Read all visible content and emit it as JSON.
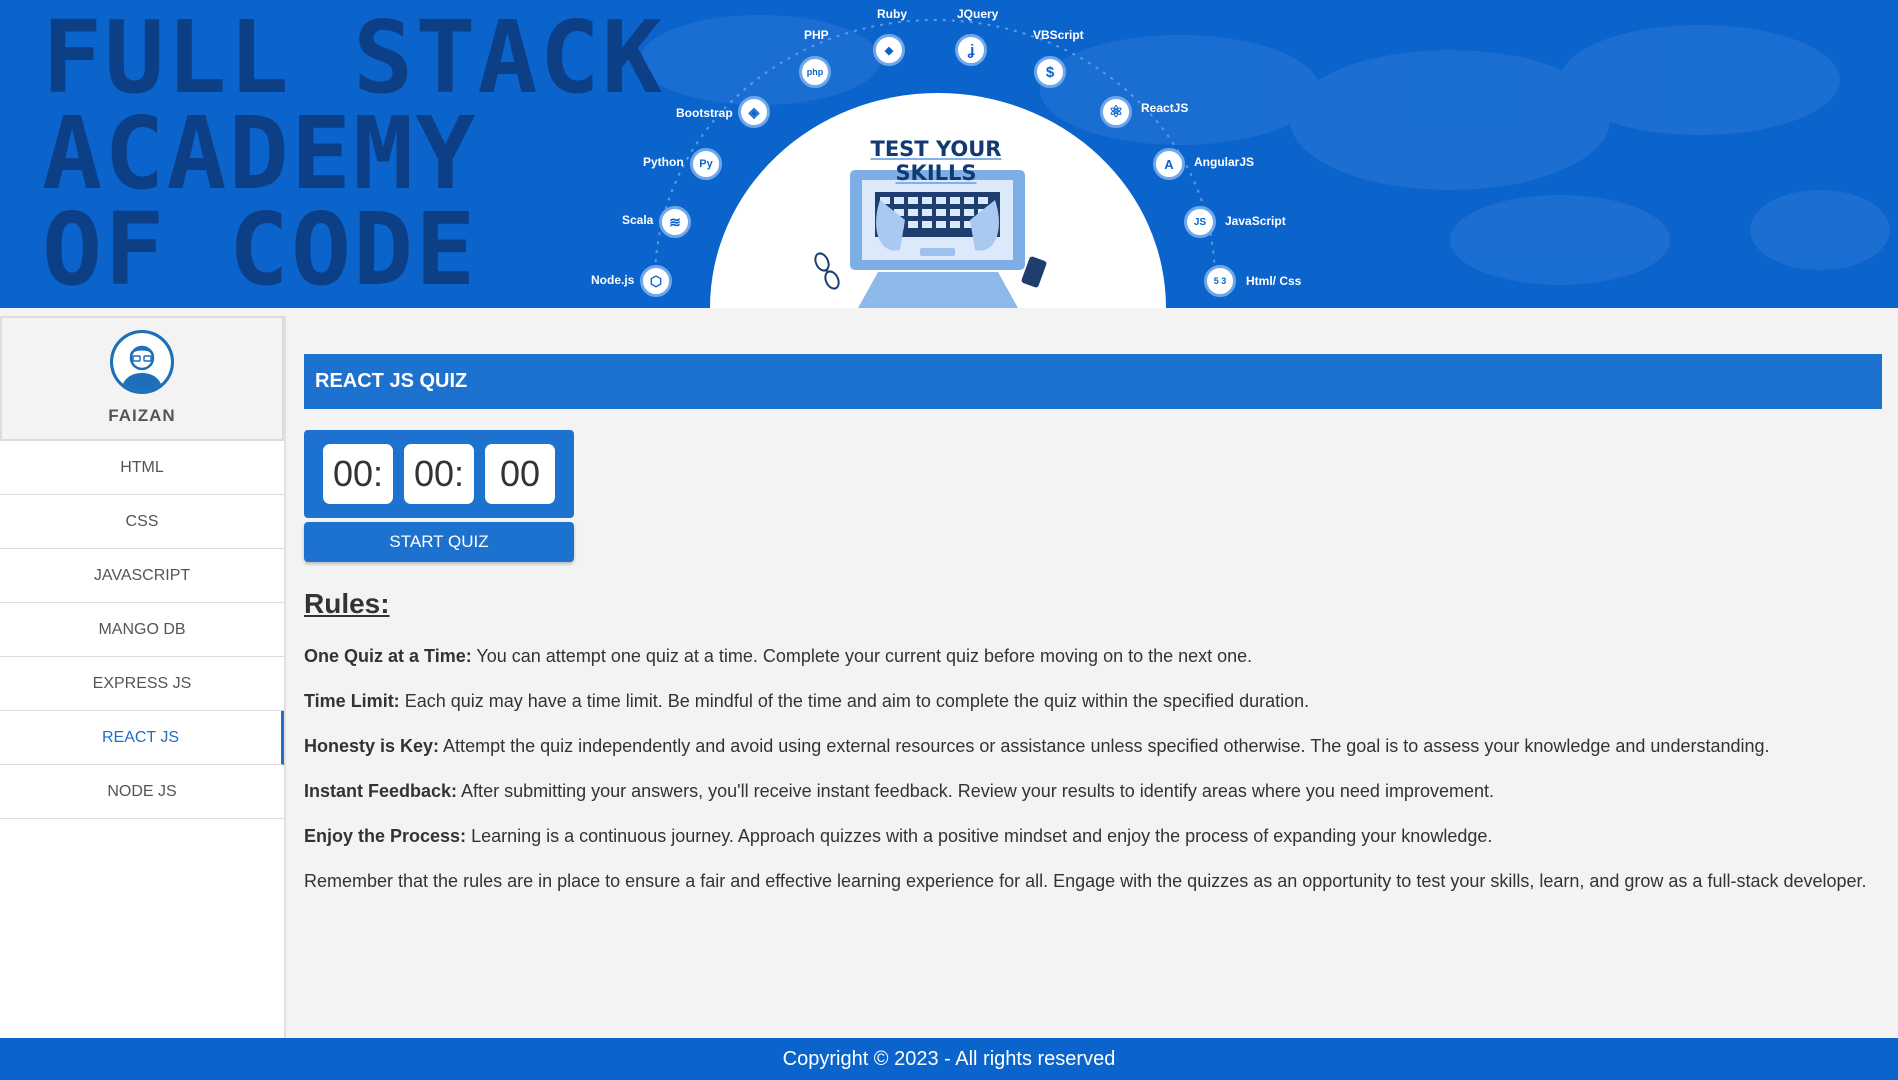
{
  "banner": {
    "brand_lines": [
      "Full Stack",
      "Academy",
      "of Code"
    ],
    "skills_title": "TEST YOUR SKILLS",
    "technologies": [
      {
        "label": "PHP",
        "icon": "php-icon",
        "glyph": "php"
      },
      {
        "label": "Ruby",
        "icon": "ruby-icon",
        "glyph": "◆"
      },
      {
        "label": "JQuery",
        "icon": "jquery-icon",
        "glyph": "ʝ"
      },
      {
        "label": "VBScript",
        "icon": "vbscript-icon",
        "glyph": "$"
      },
      {
        "label": "Bootstrap",
        "icon": "bootstrap-icon",
        "glyph": "◈"
      },
      {
        "label": "ReactJS",
        "icon": "react-icon",
        "glyph": "⚛"
      },
      {
        "label": "Python",
        "icon": "python-icon",
        "glyph": "Py"
      },
      {
        "label": "AngularJS",
        "icon": "angular-icon",
        "glyph": "A"
      },
      {
        "label": "Scala",
        "icon": "scala-icon",
        "glyph": "≋"
      },
      {
        "label": "JavaScript",
        "icon": "javascript-icon",
        "glyph": "JS"
      },
      {
        "label": "Node.js",
        "icon": "nodejs-icon",
        "glyph": "⬡"
      },
      {
        "label": "Html/ Css",
        "icon": "html-css-icon",
        "glyph": "5 3"
      }
    ]
  },
  "user": {
    "name": "FAIZAN"
  },
  "sidebar": {
    "items": [
      {
        "label": "HTML",
        "active": false
      },
      {
        "label": "CSS",
        "active": false
      },
      {
        "label": "JAVASCRIPT",
        "active": false
      },
      {
        "label": "MANGO DB",
        "active": false
      },
      {
        "label": "EXPRESS JS",
        "active": false
      },
      {
        "label": "REACT JS",
        "active": true
      },
      {
        "label": "NODE JS",
        "active": false
      }
    ]
  },
  "quiz": {
    "title": "REACT JS QUIZ",
    "timer": {
      "hours": "00:",
      "minutes": "00:",
      "seconds": "00"
    },
    "start_label": "START QUIZ"
  },
  "rules": {
    "heading": "Rules:",
    "items": [
      {
        "title": "One Quiz at a Time:",
        "text": " You can attempt one quiz at a time. Complete your current quiz before moving on to the next one."
      },
      {
        "title": "Time Limit:",
        "text": " Each quiz may have a time limit. Be mindful of the time and aim to complete the quiz within the specified duration."
      },
      {
        "title": "Honesty is Key:",
        "text": " Attempt the quiz independently and avoid using external resources or assistance unless specified otherwise. The goal is to assess your knowledge and understanding."
      },
      {
        "title": "Instant Feedback:",
        "text": " After submitting your answers, you'll receive instant feedback. Review your results to identify areas where you need improvement."
      },
      {
        "title": "Enjoy the Process:",
        "text": " Learning is a continuous journey. Approach quizzes with a positive mindset and enjoy the process of expanding your knowledge."
      }
    ],
    "closing": "Remember that the rules are in place to ensure a fair and effective learning experience for all. Engage with the quizzes as an opportunity to test your skills, learn, and grow as a full-stack developer."
  },
  "footer": {
    "text": "Copyright © 2023 - All rights reserved"
  },
  "colors": {
    "primary": "#1d72d0",
    "banner": "#0b63cc",
    "brand_text": "#0d3f86",
    "active_nav": "#1f6fc9"
  }
}
